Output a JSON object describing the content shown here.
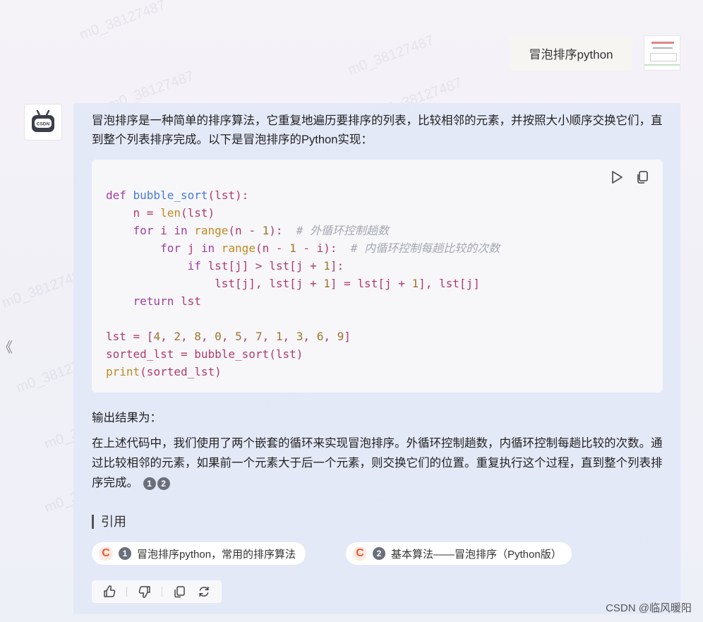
{
  "user": {
    "message": "冒泡排序python",
    "avatar_icon": "user-avatar-thumbnail"
  },
  "bot": {
    "avatar_icon": "csdn-robot-icon"
  },
  "answer": {
    "intro": "冒泡排序是一种简单的排序算法，它重复地遍历要排序的列表，比较相邻的元素，并按照大小顺序交换它们，直到整个列表排序完成。以下是冒泡排序的Python实现：",
    "code_lines": [
      "def bubble_sort(lst):",
      "    n = len(lst)",
      "    for i in range(n - 1):  # 外循环控制趟数",
      "        for j in range(n - 1 - i):  # 内循环控制每趟比较的次数",
      "            if lst[j] > lst[j + 1]:",
      "                lst[j], lst[j + 1] = lst[j + 1], lst[j]",
      "    return lst",
      "",
      "lst = [4, 2, 8, 0, 5, 7, 1, 3, 6, 9]",
      "sorted_lst = bubble_sort(lst)",
      "print(sorted_lst)"
    ],
    "code_tools": [
      "run-icon",
      "copy-icon"
    ],
    "output_label": "输出结果为：",
    "explanation": "在上述代码中，我们使用了两个嵌套的循环来实现冒泡排序。外循环控制趟数，内循环控制每趟比较的次数。通过比较相邻的元素，如果前一个元素大于后一个元素，则交换它们的位置。重复执行这个过程，直到整个列表排序完成。",
    "citations": [
      "1",
      "2"
    ]
  },
  "references": {
    "title": "引用",
    "items": [
      {
        "num": "1",
        "logo": "C",
        "label": "冒泡排序python，常用的排序算法"
      },
      {
        "num": "2",
        "logo": "C",
        "label": "基本算法——冒泡排序（Python版）"
      }
    ]
  },
  "feedback": {
    "icons": [
      "thumbs-up-icon",
      "thumbs-down-icon",
      "copy-icon",
      "regenerate-icon"
    ]
  },
  "side_arrow": "《",
  "watermark": {
    "text": "m0_38127487",
    "site_credit": "CSDN @临风暖阳"
  },
  "colors": {
    "answer_bg": "#e3e8f7",
    "code_bg": "#f7f7fa",
    "keyword": "#a03fa0",
    "function": "#4a7bd6",
    "comment": "#a5a8b0",
    "csdn_orange": "#f05a2c"
  }
}
